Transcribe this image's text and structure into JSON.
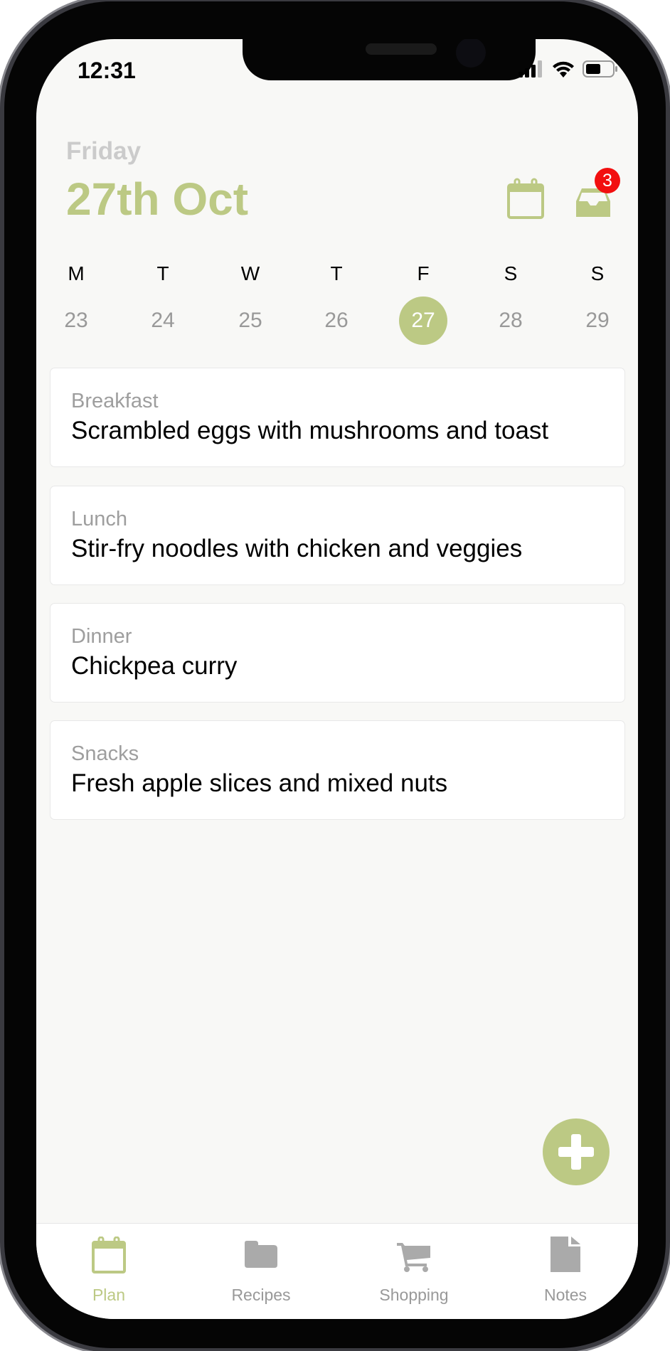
{
  "status_bar": {
    "time": "12:31"
  },
  "header": {
    "day_name": "Friday",
    "date": "27th Oct",
    "inbox_badge": "3",
    "accent_color": "#bcc984"
  },
  "week": {
    "days": [
      {
        "letter": "M",
        "number": "23"
      },
      {
        "letter": "T",
        "number": "24"
      },
      {
        "letter": "W",
        "number": "25"
      },
      {
        "letter": "T",
        "number": "26"
      },
      {
        "letter": "F",
        "number": "27",
        "selected": true
      },
      {
        "letter": "S",
        "number": "28"
      },
      {
        "letter": "S",
        "number": "29"
      }
    ]
  },
  "meals": [
    {
      "label": "Breakfast",
      "title": "Scrambled eggs with mushrooms and toast"
    },
    {
      "label": "Lunch",
      "title": "Stir-fry noodles with chicken and veggies"
    },
    {
      "label": "Dinner",
      "title": "Chickpea curry"
    },
    {
      "label": "Snacks",
      "title": "Fresh apple slices and mixed nuts"
    }
  ],
  "tabs": [
    {
      "label": "Plan",
      "icon": "calendar-icon",
      "active": true
    },
    {
      "label": "Recipes",
      "icon": "folder-icon"
    },
    {
      "label": "Shopping",
      "icon": "cart-icon"
    },
    {
      "label": "Notes",
      "icon": "document-icon"
    }
  ]
}
